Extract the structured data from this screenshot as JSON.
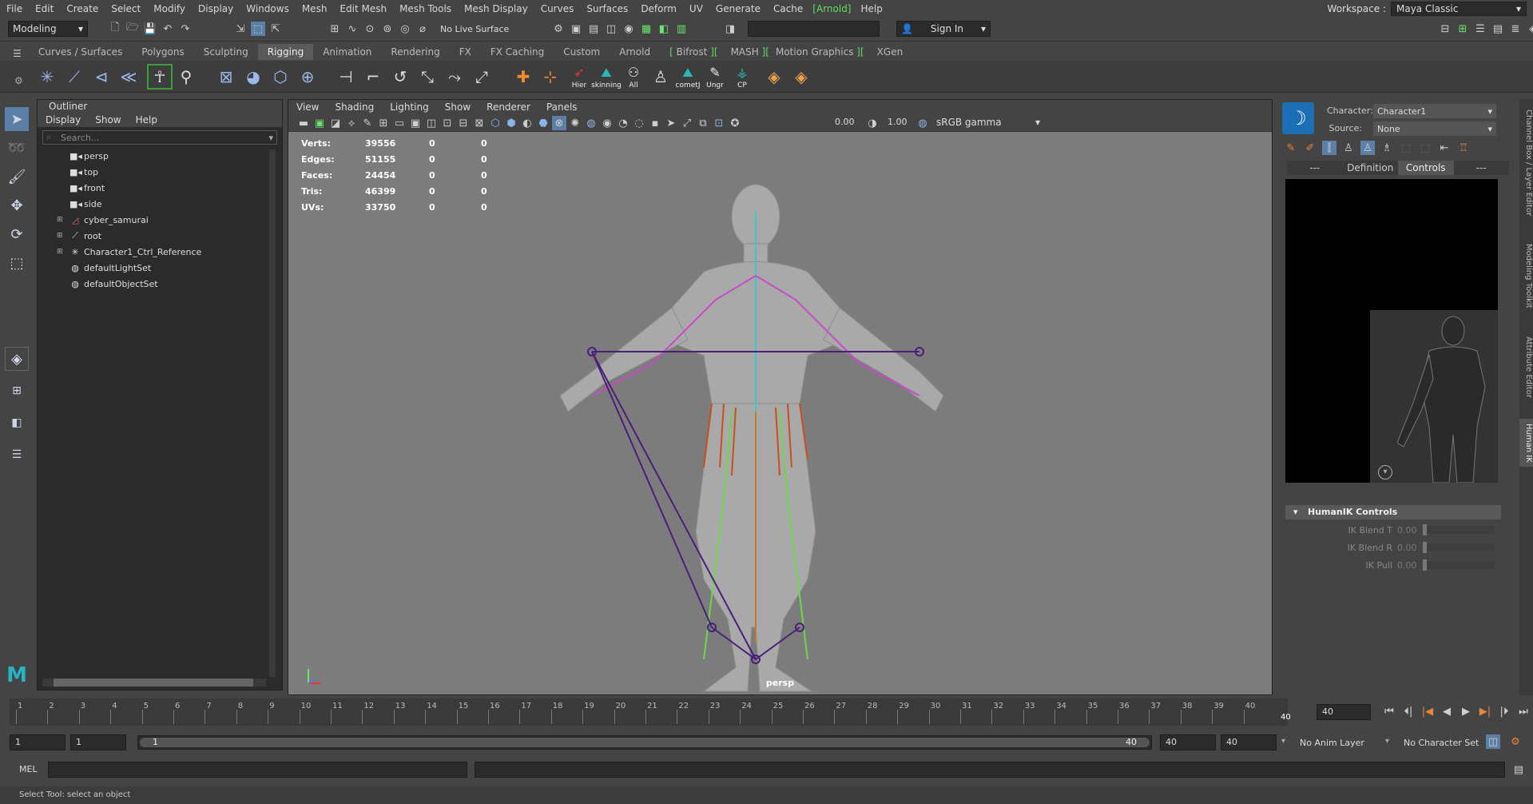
{
  "menubar": {
    "items": [
      "File",
      "Edit",
      "Create",
      "Select",
      "Modify",
      "Display",
      "Windows",
      "Mesh",
      "Edit Mesh",
      "Mesh Tools",
      "Mesh Display",
      "Curves",
      "Surfaces",
      "Deform",
      "UV",
      "Generate",
      "Cache",
      "[Arnold]",
      "Help"
    ],
    "workspace_label": "Workspace :",
    "workspace_value": "Maya Classic"
  },
  "statusline": {
    "mode": "Modeling",
    "live_surface": "No Live Surface",
    "sign_in": "Sign In"
  },
  "shelf_tabs": [
    "Curves / Surfaces",
    "Polygons",
    "Sculpting",
    "Rigging",
    "Animation",
    "Rendering",
    "FX",
    "FX Caching",
    "Custom",
    "Arnold",
    "Bifrost",
    "MASH",
    "Motion Graphics",
    "XGen"
  ],
  "shelf_active": "Rigging",
  "shelf_labels": {
    "hier": "Hier",
    "skinning": "skinning",
    "all": "All",
    "comet": "cometJ",
    "ungr": "Ungr",
    "cp": "CP"
  },
  "outliner": {
    "title": "Outliner",
    "menu": [
      "Display",
      "Show",
      "Help"
    ],
    "search_placeholder": "Search...",
    "items": [
      {
        "label": "persp",
        "icon": "camera"
      },
      {
        "label": "top",
        "icon": "camera"
      },
      {
        "label": "front",
        "icon": "camera"
      },
      {
        "label": "side",
        "icon": "camera"
      },
      {
        "label": "cyber_samurai",
        "icon": "mesh",
        "expandable": true
      },
      {
        "label": "root",
        "icon": "joint",
        "expandable": true
      },
      {
        "label": "Character1_Ctrl_Reference",
        "icon": "hik",
        "expandable": true
      },
      {
        "label": "defaultLightSet",
        "icon": "set"
      },
      {
        "label": "defaultObjectSet",
        "icon": "set"
      }
    ]
  },
  "viewport": {
    "menu": [
      "View",
      "Shading",
      "Lighting",
      "Show",
      "Renderer",
      "Panels"
    ],
    "exposure": "0.00",
    "gamma": "1.00",
    "color_space": "sRGB gamma",
    "camera": "persp",
    "hud": [
      {
        "label": "Verts:",
        "a": "39556",
        "b": "0",
        "c": "0"
      },
      {
        "label": "Edges:",
        "a": "51155",
        "b": "0",
        "c": "0"
      },
      {
        "label": "Faces:",
        "a": "24454",
        "b": "0",
        "c": "0"
      },
      {
        "label": "Tris:",
        "a": "46399",
        "b": "0",
        "c": "0"
      },
      {
        "label": "UVs:",
        "a": "33750",
        "b": "0",
        "c": "0"
      }
    ]
  },
  "human_ik": {
    "character_label": "Character:",
    "character_value": "Character1",
    "source_label": "Source:",
    "source_value": "None",
    "tabs": [
      "---",
      "Definition",
      "Controls",
      "---"
    ],
    "active_tab": "Controls",
    "controls_header": "HumanIK Controls",
    "rows": [
      {
        "name": "IK Blend T",
        "value": "0.00"
      },
      {
        "name": "IK Blend R",
        "value": "0.00"
      },
      {
        "name": "IK Pull",
        "value": "0.00"
      }
    ]
  },
  "side_tabs": [
    "Channel Box / Layer Editor",
    "Modeling Toolkit",
    "Attribute Editor",
    "Human IK"
  ],
  "timeline": {
    "ticks": [
      "1",
      "2",
      "3",
      "4",
      "5",
      "6",
      "7",
      "8",
      "9",
      "10",
      "11",
      "12",
      "13",
      "14",
      "15",
      "16",
      "17",
      "18",
      "19",
      "20",
      "21",
      "22",
      "23",
      "24",
      "25",
      "26",
      "27",
      "28",
      "29",
      "30",
      "31",
      "32",
      "33",
      "34",
      "35",
      "36",
      "37",
      "38",
      "39",
      "40"
    ],
    "end_label": "40",
    "current_frame": "40"
  },
  "range": {
    "start": "1",
    "playback_start": "1",
    "slider_start": "1",
    "slider_end": "40",
    "playback_end": "40",
    "end": "40",
    "anim_layer": "No Anim Layer",
    "character_set": "No Character Set"
  },
  "command": {
    "lang": "MEL"
  },
  "help_line": "Select Tool: select an object"
}
